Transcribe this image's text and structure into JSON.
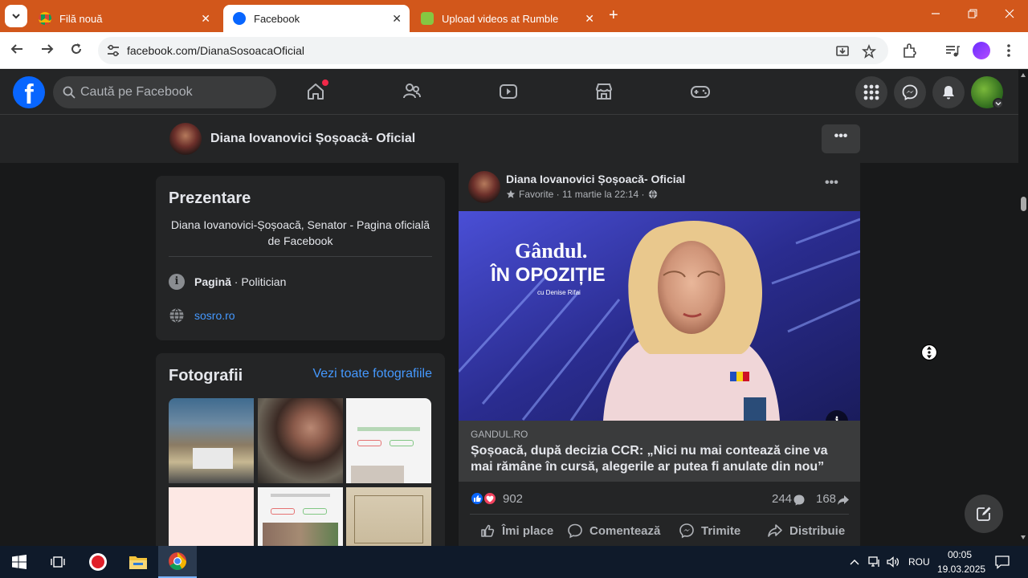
{
  "browser": {
    "tabs": [
      {
        "title": "Filă nouă"
      },
      {
        "title": "Facebook"
      },
      {
        "title": "Upload videos at Rumble"
      }
    ],
    "close_glyph": "✕",
    "new_tab_glyph": "+",
    "address": "facebook.com/DianaSosoacaOficial"
  },
  "fb": {
    "search_placeholder": "Caută pe Facebook"
  },
  "page": {
    "name": "Diana Iovanovici Șoșoacă- Oficial",
    "more_glyph": "•••"
  },
  "intro": {
    "heading": "Prezentare",
    "bio": "Diana Iovanovici-Șoșoacă, Senator - Pagina oficială de Facebook",
    "category_bold": "Pagină",
    "category_rest": " · Politician",
    "website": "sosro.ro"
  },
  "photos": {
    "heading": "Fotografii",
    "see_all": "Vezi toate fotografiile"
  },
  "post": {
    "author": "Diana Iovanovici Șoșoacă- Oficial",
    "meta": "Favorite · 11 martie la 22:14 ·",
    "image_text_brand": "Gândul.",
    "image_text_show": "ÎN OPOZIȚIE",
    "image_text_host": "cu Denise Rifai",
    "link_domain": "GANDUL.RO",
    "link_title": "Șoșoacă, după decizia CCR: „Nici nu mai contează cine va mai rămâne în cursă, alegerile ar putea fi anulate din nou”",
    "reactions": "902",
    "comments": "244",
    "shares": "168",
    "actions": {
      "like": "Îmi place",
      "comment": "Comentează",
      "send": "Trimite",
      "share": "Distribuie"
    }
  },
  "taskbar": {
    "language": "ROU",
    "time": "00:05",
    "date": "19.03.2025"
  },
  "colors": {
    "tab_strip": "#d2571b",
    "fb_blue": "#0866ff",
    "link_blue": "#4599ff",
    "surface": "#242526",
    "background": "#18191a"
  }
}
